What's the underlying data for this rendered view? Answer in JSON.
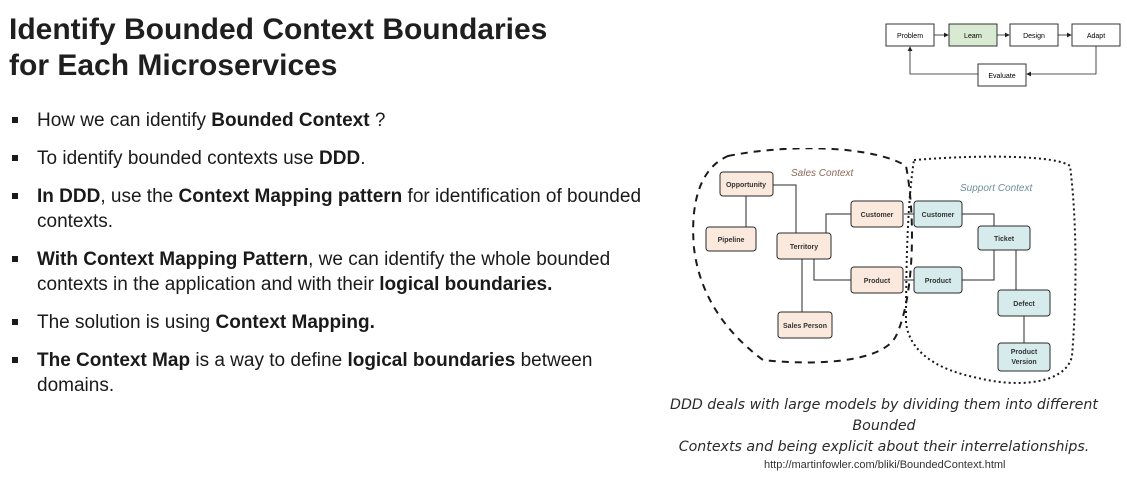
{
  "slide": {
    "title_line1": "Identify Bounded Context Boundaries",
    "title_line2": "for Each Microservices",
    "bullets": [
      {
        "segments": [
          {
            "text": "How we can identify ",
            "bold": false
          },
          {
            "text": "Bounded Context",
            "bold": true
          },
          {
            "text": " ?",
            "bold": false
          }
        ]
      },
      {
        "segments": [
          {
            "text": "To identify bounded contexts use ",
            "bold": false
          },
          {
            "text": "DDD",
            "bold": true
          },
          {
            "text": ".",
            "bold": false
          }
        ]
      },
      {
        "segments": [
          {
            "text": "In DDD",
            "bold": true
          },
          {
            "text": ", use the ",
            "bold": false
          },
          {
            "text": "Context Mapping pattern",
            "bold": true
          },
          {
            "text": " for identification of bounded contexts.",
            "bold": false
          }
        ]
      },
      {
        "segments": [
          {
            "text": "With Context Mapping Pattern",
            "bold": true
          },
          {
            "text": ", we can identify the whole bounded contexts in the application and with their ",
            "bold": false
          },
          {
            "text": "logical boundaries.",
            "bold": true
          }
        ]
      },
      {
        "segments": [
          {
            "text": "The solution is using ",
            "bold": false
          },
          {
            "text": "Context Mapping.",
            "bold": true
          }
        ]
      },
      {
        "segments": [
          {
            "text": "The Context Map",
            "bold": true
          },
          {
            "text": " is a way to define ",
            "bold": false
          },
          {
            "text": "logical boundaries",
            "bold": true
          },
          {
            "text": " between domains.",
            "bold": false
          }
        ]
      }
    ]
  },
  "flow_diagram": {
    "steps": [
      "Problem",
      "Learn",
      "Design",
      "Adapt"
    ],
    "feedback_step": "Evaluate",
    "highlight_color": "#d9ead3"
  },
  "context_map": {
    "sales_label": "Sales Context",
    "support_label": "Support Context",
    "sales_nodes": {
      "opportunity": "Opportunity",
      "pipeline": "Pipeline",
      "territory": "Territory",
      "customer": "Customer",
      "product": "Product",
      "sales_person": "Sales Person"
    },
    "support_nodes": {
      "customer": "Customer",
      "ticket": "Ticket",
      "product": "Product",
      "defect": "Defect",
      "product_version_line1": "Product",
      "product_version_line2": "Version"
    },
    "sales_fill": "#fbe9dd",
    "support_fill": "#d6ecec"
  },
  "caption_line1": "DDD deals with large models by dividing them into different Bounded",
  "caption_line2": "Contexts and being explicit about their interrelationships.",
  "source_url": "http://martinfowler.com/bliki/BoundedContext.html"
}
